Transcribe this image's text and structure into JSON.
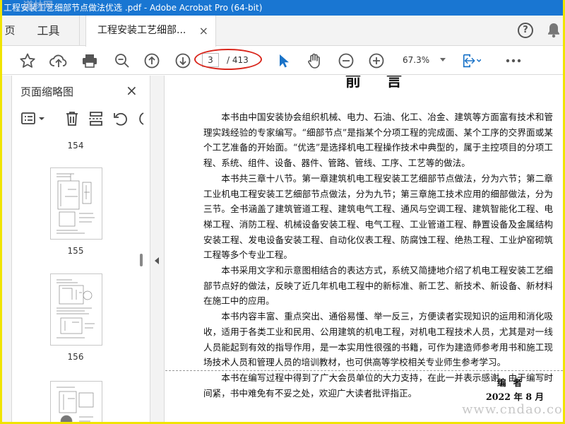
{
  "window": {
    "title": "工程安装工艺细部节点做法优选 .pdf - Adobe Acrobat Pro (64-bit)"
  },
  "tabs": {
    "home": "页",
    "tools": "工具",
    "document": "工程安装工艺细部...",
    "close": "×"
  },
  "toolbar": {
    "current_page": "3",
    "total_pages": "/ 413",
    "zoom": "67.3%"
  },
  "sidebar": {
    "title": "页面缩略图",
    "close": "×",
    "thumbnails": [
      {
        "label": "154"
      },
      {
        "label": "155"
      },
      {
        "label": "156"
      }
    ]
  },
  "document": {
    "heading": "前言",
    "paragraphs": [
      "本书由中国安装协会组织机械、电力、石油、化工、冶金、建筑等方面富有技术和管理实践经验的专家编写。“细部节点”是指某个分项工程的完成面、某个工序的交界面或某个工艺准备的开始面。“优选”是选择机电工程操作技术中典型的，属于主控项目的分项工程、系统、组件、设备、器件、管路、管线、工序、工艺等的做法。",
      "本书共三章十八节。第一章建筑机电工程安装工艺细部节点做法，分为六节；第二章工业机电工程安装工艺细部节点做法，分为九节；第三章施工技术应用的细部做法，分为三节。全书涵盖了建筑管道工程、建筑电气工程、通风与空调工程、建筑智能化工程、电梯工程、消防工程、机械设备安装工程、电气工程、工业管道工程、静置设备及金属结构安装工程、发电设备安装工程、自动化仪表工程、防腐蚀工程、绝热工程、工业炉窑砌筑工程等多个专业工程。",
      "本书采用文字和示意图相结合的表达方式，系统又简捷地介绍了机电工程安装工艺细部节点好的做法，反映了近几年机电工程中的新标准、新工艺、新技术、新设备、新材料在施工中的应用。",
      "本书内容丰富、重点突出、通俗易懂、举一反三，方便读者实现知识的运用和消化吸收，适用于各类工业和民用、公用建筑的机电工程，对机电工程技术人员，尤其是对一线人员能起到有效的指导作用，是一本实用性很强的书籍，可作为建造师参考用书和施工现场技术人员和管理人员的培训教材，也可供高等学校相关专业师生参考学习。",
      "本书在编写过程中得到了广大会员单位的大力支持，在此一并表示感谢。由于编写时间紧，书中难免有不妥之处，欢迎广大读者批评指正。"
    ],
    "signer": "编者",
    "date": "2022 年 8 月",
    "watermark": "www.cndao.com"
  },
  "watermark_top": "道林网",
  "colors": {
    "titlebar": "#1976d2",
    "highlight_oval": "#d9261c",
    "page_bg": "#f0e400",
    "select_tool": "#1a73c8"
  }
}
